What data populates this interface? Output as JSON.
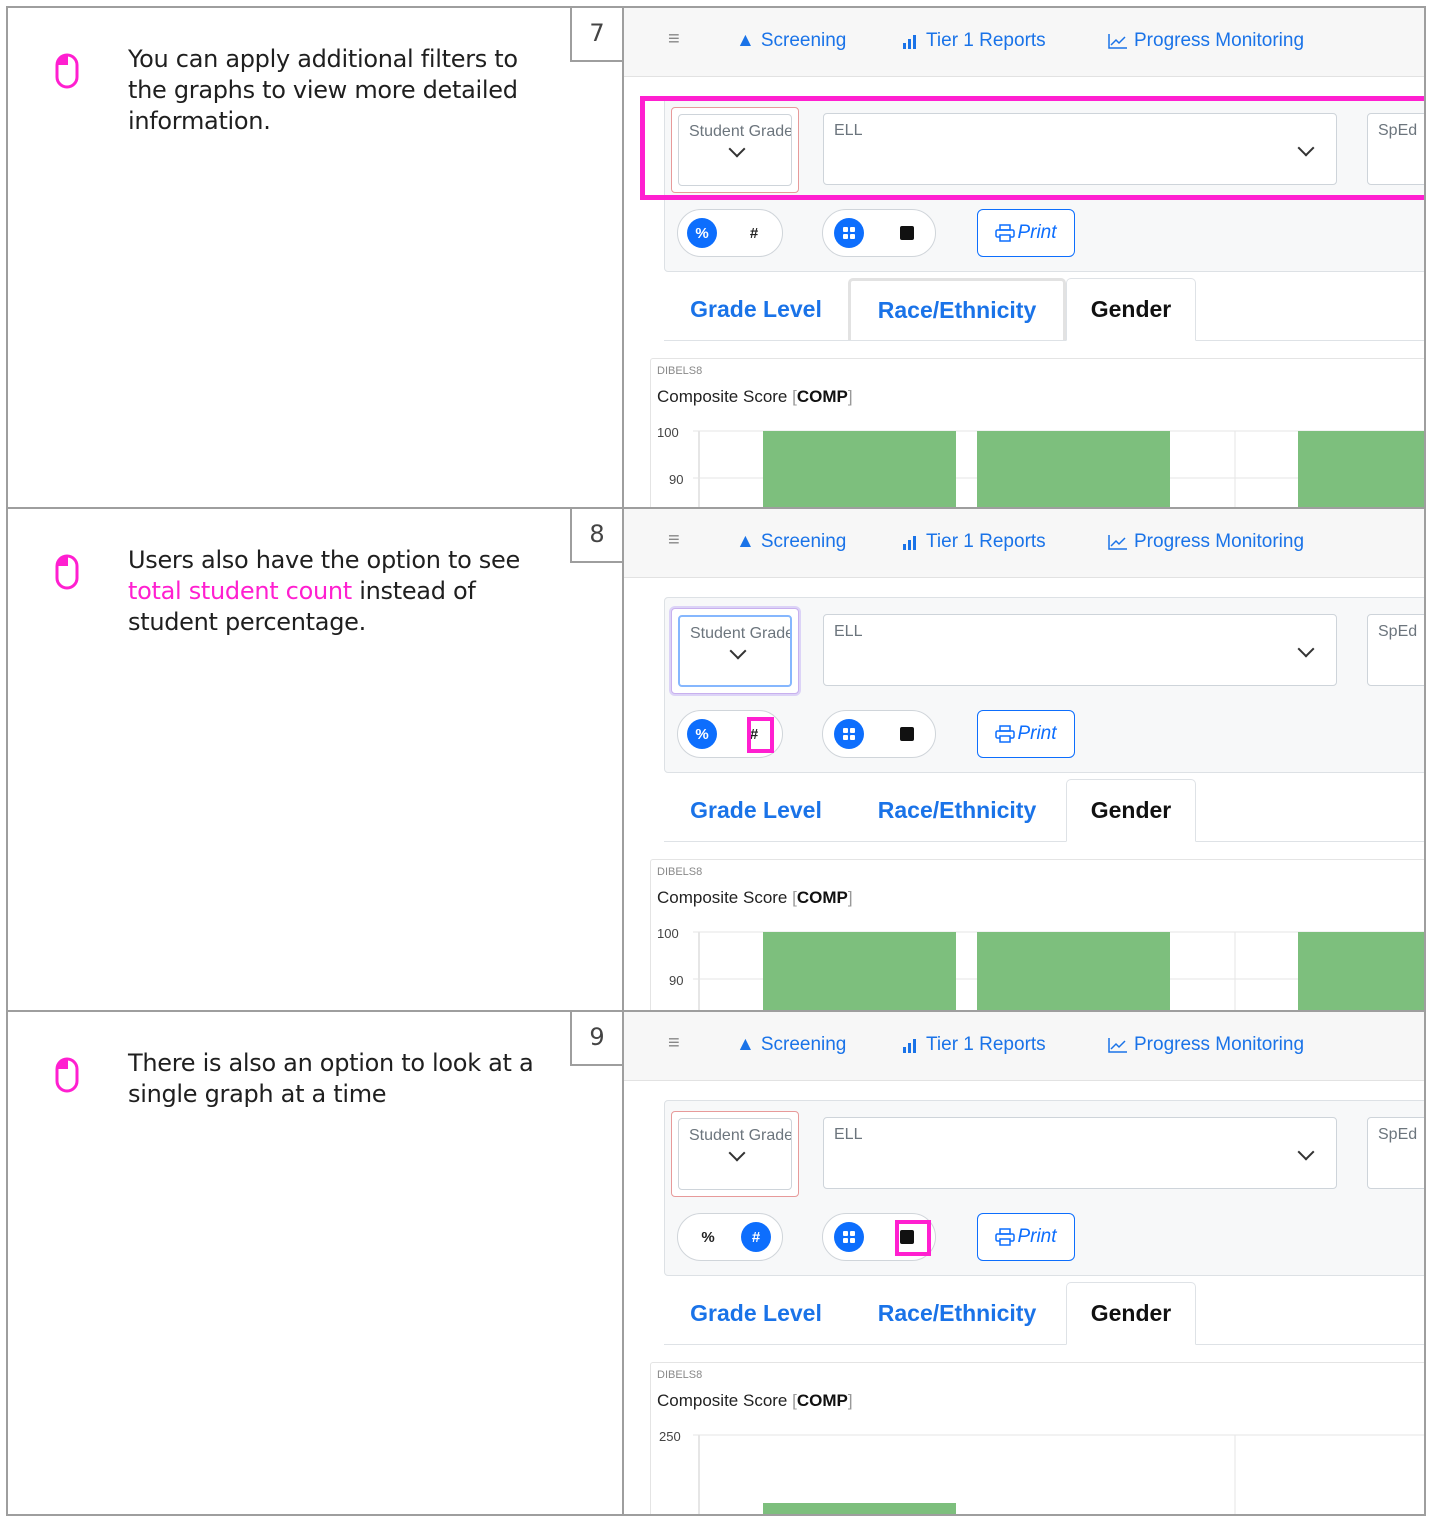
{
  "nav": {
    "menu_icon": "hamburger-icon",
    "screening": "Screening",
    "tier1": "Tier 1 Reports",
    "progress": "Progress Monitoring"
  },
  "filters": {
    "student_grade": "Student Grade",
    "ell": "ELL",
    "sped": "SpEd"
  },
  "toggles": {
    "percent": "%",
    "count": "#",
    "print": "Print"
  },
  "tabs": {
    "grade_level": "Grade Level",
    "race": "Race/Ethnicity",
    "gender": "Gender"
  },
  "steps": [
    {
      "number": "7",
      "text": "You can apply additional filters to the graphs to view more detailed information.",
      "view": {
        "value_mode": "percent",
        "layout": "grid"
      },
      "chart": {
        "source": "DIBELS8",
        "title": "Composite Score ",
        "title_code": "COMP",
        "y_ticks": [
          "100",
          "90"
        ],
        "bar_tops": [
          100,
          100,
          100
        ]
      }
    },
    {
      "number": "8",
      "text_before": "Users also have the option to see ",
      "text_highlight": "total student count",
      "text_after": " instead of student percentage.",
      "view": {
        "value_mode": "percent",
        "layout": "grid"
      },
      "chart": {
        "source": "DIBELS8",
        "title": "Composite Score ",
        "title_code": "COMP",
        "y_ticks": [
          "100",
          "90"
        ],
        "bar_tops": [
          100,
          100,
          100
        ]
      }
    },
    {
      "number": "9",
      "text": "There is also an option to look at a single graph at a time",
      "view": {
        "value_mode": "count",
        "layout": "grid"
      },
      "chart": {
        "source": "DIBELS8",
        "title": "Composite Score ",
        "title_code": "COMP",
        "y_ticks": [
          "250"
        ]
      }
    }
  ],
  "colors": {
    "highlight": "#ff1fd0",
    "link": "#1a73e8",
    "bar": "#7dbf7d",
    "active_toggle": "#0d6efd"
  }
}
